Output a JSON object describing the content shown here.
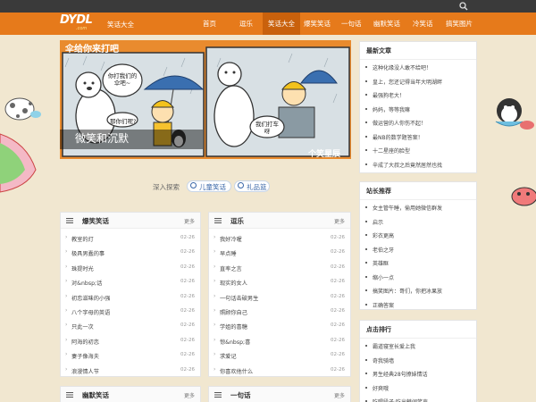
{
  "header": {
    "logo_text": "DYDL",
    "logo_sub": ".com",
    "site_name": "笑话大全",
    "nav": [
      "首页",
      "逗乐",
      "笑话大全",
      "爆笑笑话",
      "一句话",
      "幽默笑话",
      "冷笑话",
      "搞笑图片"
    ]
  },
  "banner": {
    "headline": "伞给你来打吧",
    "bubble1": "你打我们的伞吧~",
    "bubble2": "你呢?",
    "bubble3": "那你们呢?",
    "bubble4": "我们打车呀",
    "bottom_text": "个笑星辰",
    "caption": "微笑和沉默"
  },
  "tags": [
    "深入探索",
    "儿童笑话",
    "礼品篮"
  ],
  "panels": [
    {
      "title": "爆笑笑话",
      "more": "更多",
      "items": [
        {
          "t": "教室的灯",
          "d": "02-26"
        },
        {
          "t": "极具男蠢的事",
          "d": "02-26"
        },
        {
          "t": "珠提时光",
          "d": "02-26"
        },
        {
          "t": "对&nbsp;话",
          "d": "02-26"
        },
        {
          "t": "初恋滋味的小强",
          "d": "02-26"
        },
        {
          "t": "八个字母的英语",
          "d": "02-26"
        },
        {
          "t": "只此一次",
          "d": "02-26"
        },
        {
          "t": "阿海的初恋",
          "d": "02-26"
        },
        {
          "t": "妻子像海夫",
          "d": "02-26"
        },
        {
          "t": "浪漫情人节",
          "d": "02-26"
        }
      ]
    },
    {
      "title": "逗乐",
      "more": "更多",
      "items": [
        {
          "t": "我好冷喔",
          "d": "02-26"
        },
        {
          "t": "早点睡",
          "d": "02-26"
        },
        {
          "t": "直率之言",
          "d": "02-26"
        },
        {
          "t": "现实的女人",
          "d": "02-26"
        },
        {
          "t": "一句话击破男生",
          "d": "02-26"
        },
        {
          "t": "照顾你自己",
          "d": "02-26"
        },
        {
          "t": "学姐的喜糖",
          "d": "02-26"
        },
        {
          "t": "惊&nbsp;喜",
          "d": "02-26"
        },
        {
          "t": "求爱记",
          "d": "02-26"
        },
        {
          "t": "你喜欢他什么",
          "d": "02-26"
        }
      ]
    },
    {
      "title": "幽默笑话",
      "more": "更多",
      "items": []
    },
    {
      "title": "一句话",
      "more": "更多",
      "items": []
    }
  ],
  "sidebar": {
    "latest": {
      "title": "最新文章",
      "items": [
        "这种化缘没人敢不给吧！",
        "皇上，您还记得当年大明湖畔",
        "最强狗老大！",
        "妈妈，等等我嘛",
        "做运营的人你伤不起！",
        "最NB的数学题答案！",
        "十二星座的脸型",
        "辛成了大叔之后竟然居然也找"
      ]
    },
    "recommend": {
      "title": "站长推荐",
      "items": [
        "女主管午睡，偷用她微信群发",
        "启示",
        "彩衣更高",
        "老伯之牙",
        "英雄眶",
        "缩小一点",
        "搞笑图片：哥们，你把冰果放",
        "正确答案"
      ]
    },
    "ranking": {
      "title": "点击排行",
      "items": [
        "霸道寝室长爱上我",
        "奇我骑墙",
        "男生经典28句撩妹情话",
        "好爽哦",
        "吃喝段子:吃出韩阔笑声"
      ]
    }
  }
}
